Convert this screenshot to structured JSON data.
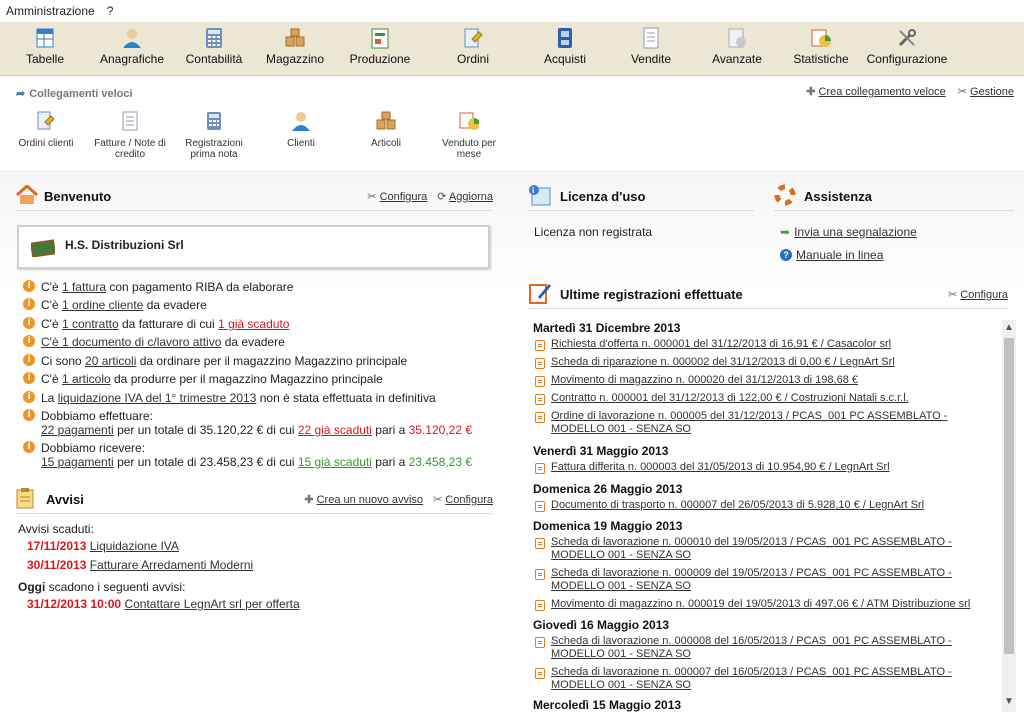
{
  "menu": [
    "Amministrazione",
    "?"
  ],
  "toolbar": [
    {
      "label": "Tabelle",
      "icon": "tables-icon",
      "color": "#3a7dc9"
    },
    {
      "label": "Anagrafiche",
      "icon": "person-icon",
      "color": "#2f7fd0"
    },
    {
      "label": "Contabilità",
      "icon": "calculator-icon",
      "color": "#5a7fb0"
    },
    {
      "label": "Magazzino",
      "icon": "boxes-icon",
      "color": "#c9873a"
    },
    {
      "label": "Produzione",
      "icon": "production-icon",
      "color": "#3c8f3c"
    },
    {
      "label": "Ordini",
      "icon": "order-icon",
      "color": "#e0b030"
    },
    {
      "label": "Acquisti",
      "icon": "purchase-icon",
      "color": "#2e5fa8"
    },
    {
      "label": "Vendite",
      "icon": "sales-icon",
      "color": "#9ab"
    },
    {
      "label": "Avanzate",
      "icon": "advanced-icon",
      "color": "#aab"
    },
    {
      "label": "Statistiche",
      "icon": "statistics-icon",
      "color": "#e05a2a"
    },
    {
      "label": "Configurazione",
      "icon": "tools-icon",
      "color": "#777"
    }
  ],
  "quick": {
    "title": "Collegamenti veloci",
    "create": "Crea collegamento veloce",
    "manage": "Gestione",
    "items": [
      {
        "label": "Ordini clienti",
        "icon": "order-icon"
      },
      {
        "label": "Fatture / Note di credito",
        "icon": "invoice-icon"
      },
      {
        "label": "Registrazioni prima nota",
        "icon": "calculator-icon"
      },
      {
        "label": "Clienti",
        "icon": "person-icon"
      },
      {
        "label": "Articoli",
        "icon": "boxes-icon"
      },
      {
        "label": "Venduto per mese",
        "icon": "statistics-icon"
      }
    ]
  },
  "welcome": {
    "title": "Benvenuto",
    "configure": "Configura",
    "refresh": "Aggiorna",
    "company": "H.S. Distribuzioni Srl",
    "n1": {
      "a": "C'è ",
      "l": "1 fattura",
      "b": " con pagamento RIBA da elaborare"
    },
    "n2": {
      "a": "C'è ",
      "l": "1 ordine cliente",
      "b": " da evadere"
    },
    "n3": {
      "a": "C'è ",
      "l": "1 contratto",
      "b": " da fatturare di cui ",
      "r": "1 già scaduto"
    },
    "n4": {
      "l": "C'è 1 documento di c/lavoro attivo",
      "b": " da evadere"
    },
    "n5": {
      "a": "Ci sono ",
      "l": "20 articoli",
      "b": " da ordinare per il magazzino Magazzino principale"
    },
    "n6": {
      "a": "C'è ",
      "l": "1 articolo",
      "b": " da produrre per il magazzino Magazzino principale"
    },
    "n7": {
      "a": "La ",
      "l": "liquidazione IVA del 1° trimestre 2013",
      "b": " non è stata effettuata in definitiva"
    },
    "n8": {
      "h": "Dobbiamo effettuare:",
      "l": "22 pagamenti",
      "b": " per un totale di 35.120,22 € di cui ",
      "r": "22 già scaduti",
      "c": " pari a ",
      "v": "35.120,22 €"
    },
    "n9": {
      "h": "Dobbiamo ricevere:",
      "l": "15 pagamenti",
      "b": " per un totale di 23.458,23 € di cui ",
      "g": "15 già scaduti",
      "c": " pari a ",
      "v": "23.458,23 €"
    }
  },
  "notices": {
    "title": "Avvisi",
    "create": "Crea un nuovo avviso",
    "configure": "Configura",
    "expired": "Avvisi scaduti:",
    "items": [
      {
        "date": "17/11/2013",
        "text": "Liquidazione IVA"
      },
      {
        "date": "30/11/2013",
        "text": "Fatturare Arredamenti Moderni"
      }
    ],
    "today_bold": "Oggi",
    "today_rest": " scadono i seguenti avvisi:",
    "today": {
      "date": "31/12/2013 10:00",
      "text": "Contattare LegnArt srl per offerta"
    }
  },
  "license": {
    "title": "Licenza d'uso",
    "status": "Licenza non registrata"
  },
  "support": {
    "title": "Assistenza",
    "report": "Invia una segnalazione",
    "manual": "Manuale in linea"
  },
  "registrations": {
    "title": "Ultime registrazioni effettuate",
    "configure": "Configura",
    "d1": "Martedì 31 Dicembre 2013",
    "r1": "Richiesta d'offerta n. 000001 del 31/12/2013 di 16,91 € / Casacolor srl",
    "r2": "Scheda di riparazione n. 000002 del 31/12/2013 di 0,00 € / LegnArt Srl",
    "r3": "Movimento di magazzino n. 000020 del 31/12/2013 di 198,68 €",
    "r4": "Contratto n. 000001 del 31/12/2013 di 122,00 € / Costruzioni Natali s.c.r.l.",
    "r5": "Ordine di lavorazione n. 000005 del 31/12/2013 / PCAS_001 PC ASSEMBLATO - MODELLO 001 - SENZA SO",
    "d2": "Venerdì 31 Maggio 2013",
    "r6": "Fattura differita n. 000003 del 31/05/2013 di 10.954,90 € / LegnArt Srl",
    "d3": "Domenica 26 Maggio 2013",
    "r7": "Documento di trasporto n. 000007 del 26/05/2013 di 5.928,10 € / LegnArt Srl",
    "d4": "Domenica 19 Maggio 2013",
    "r8": "Scheda di lavorazione n. 000010 del 19/05/2013 / PCAS_001 PC ASSEMBLATO - MODELLO 001 - SENZA SO",
    "r9": "Scheda di lavorazione n. 000009 del 19/05/2013 / PCAS_001 PC ASSEMBLATO - MODELLO 001 - SENZA SO",
    "r10": "Movimento di magazzino n. 000019 del 19/05/2013 di 497,06 € / ATM Distribuzione srl",
    "d5": "Giovedì 16 Maggio 2013",
    "r11": "Scheda di lavorazione n. 000008 del 16/05/2013 / PCAS_001 PC ASSEMBLATO - MODELLO 001 - SENZA SO",
    "r12": "Scheda di lavorazione n. 000007 del 16/05/2013 / PCAS_001 PC ASSEMBLATO - MODELLO 001 - SENZA SO",
    "d6": "Mercoledì 15 Maggio 2013"
  }
}
